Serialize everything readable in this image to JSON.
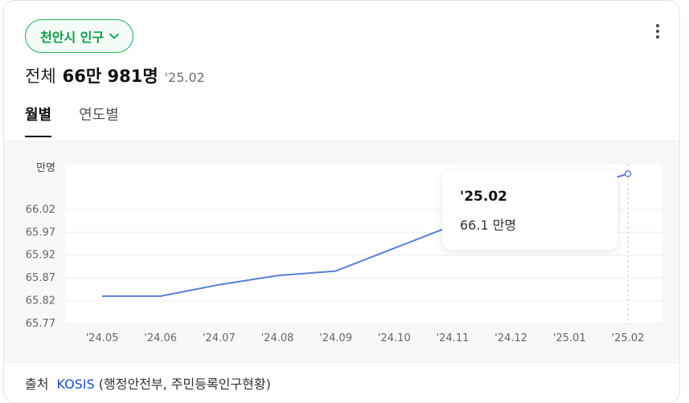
{
  "header": {
    "chip_label": "천안시 인구",
    "headline_label": "전체",
    "headline_value": "66만 981명",
    "headline_date": "'25.02"
  },
  "tabs": [
    {
      "label": "월별",
      "active": true
    },
    {
      "label": "연도별",
      "active": false
    }
  ],
  "tooltip": {
    "date": "'25.02",
    "value": "66.1 만명"
  },
  "source": {
    "label": "출처",
    "link": "KOSIS",
    "detail": "(행정안전부, 주민등록인구현황)"
  },
  "colors": {
    "accent_green": "#19b55c",
    "line_blue": "#5a7fd6"
  },
  "chart_data": {
    "type": "line",
    "unit_label": "만명",
    "x": [
      "'24.05",
      "'24.06",
      "'24.07",
      "'24.08",
      "'24.09",
      "'24.10",
      "'24.11",
      "'24.12",
      "'25.01",
      "'25.02"
    ],
    "series": [
      {
        "values": [
          65.83,
          65.83,
          65.855,
          65.875,
          65.885,
          65.935,
          65.985,
          66.03,
          66.06,
          66.098
        ]
      }
    ],
    "yticks": [
      "65.77",
      "65.82",
      "65.87",
      "65.92",
      "65.97",
      "66.02"
    ],
    "ylim": [
      65.77,
      66.12
    ],
    "grid": true,
    "highlight_index": 9
  }
}
